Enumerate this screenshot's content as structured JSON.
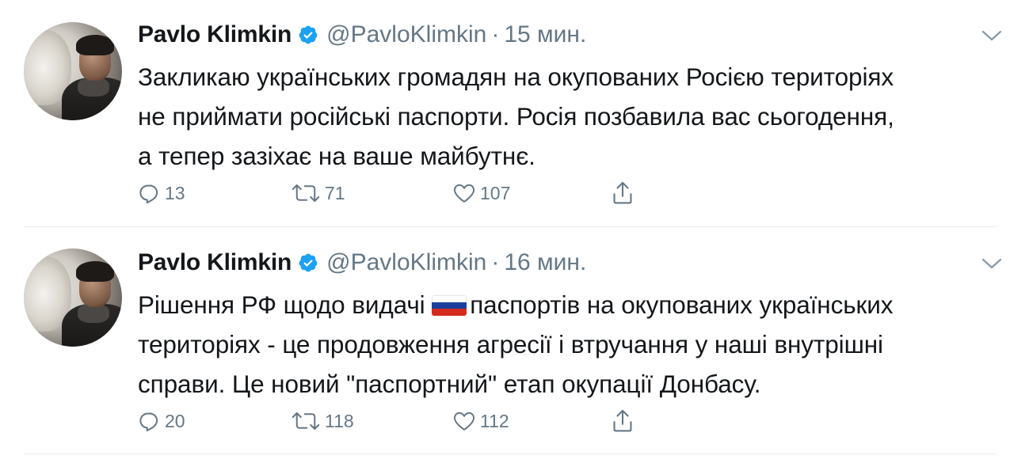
{
  "tweets": [
    {
      "author_name": "Pavlo Klimkin",
      "handle": "@PavloKlimkin",
      "separator": "·",
      "time": "15 мин.",
      "text_lines": [
        "Закликаю українських громадян на окупованих Росією територіях",
        "не приймати російські паспорти. Росія позбавила вас сьогодення,",
        "а тепер зазіхає на ваше майбутнє."
      ],
      "replies": "13",
      "retweets": "71",
      "likes": "107"
    },
    {
      "author_name": "Pavlo Klimkin",
      "handle": "@PavloKlimkin",
      "separator": "·",
      "time": "16 мин.",
      "text_line1_before_flag": "Рішення РФ щодо видачі ",
      "flag_icon": "russia-flag-icon",
      "text_line1_after_flag": "паспортів на окупованих українських",
      "text_lines": [
        "територіях - це продовження агресії і втручання у наші внутрішні",
        "справи. Це новий \"паспортний\" етап окупації Донбасу."
      ],
      "replies": "20",
      "retweets": "118",
      "likes": "112"
    }
  ],
  "icons": {
    "verified": "verified-badge-icon",
    "reply": "reply-icon",
    "retweet": "retweet-icon",
    "like": "heart-icon",
    "share": "share-icon",
    "more": "chevron-down-icon"
  },
  "colors": {
    "text": "#14171a",
    "secondary": "#657786",
    "verified": "#1da1f2",
    "divider": "#e6ecf0"
  }
}
